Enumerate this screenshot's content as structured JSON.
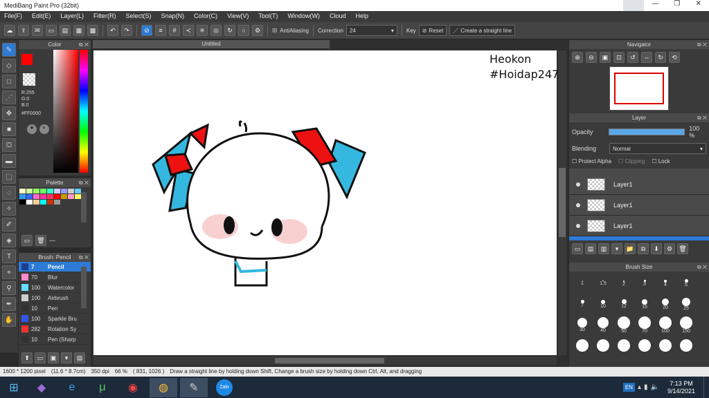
{
  "app": {
    "title": "MediBang Paint Pro (32bit)"
  },
  "menu": [
    "File(F)",
    "Edit(E)",
    "Layer(L)",
    "Filter(R)",
    "Select(S)",
    "Snap(N)",
    "Color(C)",
    "View(V)",
    "Tool(T)",
    "Window(W)",
    "Cloud",
    "Help"
  ],
  "toolbar": {
    "antialias_label": "AntiAliasing",
    "correction_label": "Correction",
    "correction_value": "24",
    "key_label": "Key",
    "reset_label": "Reset",
    "straight_line_label": "Create a straight line"
  },
  "color_panel": {
    "title": "Color",
    "r": "R:255",
    "g": "G:0",
    "b": "B:0",
    "hex": "#FF0000",
    "primary": "#ff0000",
    "secondary": "#ff8c00"
  },
  "palette": {
    "title": "Palette",
    "more_label": "---",
    "colors": [
      "#ffffcc",
      "#ccff99",
      "#99ff66",
      "#66ff66",
      "#33ffcc",
      "#ccccff",
      "#9999ff",
      "#cccccc",
      "#66ccff",
      "#3399ff",
      "#3366ff",
      "#ff66cc",
      "#ff3399",
      "#ff3366",
      "#ff0000",
      "#cc9900",
      "#ff99cc",
      "#ffff66",
      "#000000",
      "#ffffff",
      "#ffcc99",
      "#00ffff",
      "#cc3300",
      "#999999"
    ]
  },
  "brush_panel": {
    "title": "Brush: Pencil",
    "items": [
      {
        "size": "7",
        "name": "Pencil",
        "color": "#1f3e8c"
      },
      {
        "size": "70",
        "name": "Blur",
        "color": "#ff88cc"
      },
      {
        "size": "100",
        "name": "Watercolor",
        "color": "#66ddff"
      },
      {
        "size": "100",
        "name": "Airbrush",
        "color": "#cccccc"
      },
      {
        "size": "10",
        "name": "Pen",
        "color": "#333333"
      },
      {
        "size": "100",
        "name": "Sparkle Bru",
        "color": "#3355ee"
      },
      {
        "size": "282",
        "name": "Rotation Sy",
        "color": "#ff3333"
      },
      {
        "size": "10",
        "name": "Pen (Sharp",
        "color": "#333333"
      }
    ]
  },
  "canvas": {
    "tab_title": "Untitled",
    "overlay_line1": "Heokon",
    "overlay_line2": "#Hoidap247"
  },
  "navigator": {
    "title": "Navigator"
  },
  "layer_panel": {
    "title": "Layer",
    "opacity_label": "Opacity",
    "opacity_value": "100 %",
    "blending_label": "Blending",
    "blending_value": "Normal",
    "protect_alpha": "Protect Alpha",
    "clipping": "Clipping",
    "lock": "Lock",
    "layers": [
      "Layer1",
      "Layer1",
      "Layer1"
    ]
  },
  "brush_size_panel": {
    "title": "Brush Size",
    "sizes": [
      "1",
      "1.5",
      "2",
      "3",
      "4",
      "5",
      "7",
      "10",
      "12",
      "15",
      "20",
      "25",
      "30",
      "40",
      "50",
      "70",
      "100",
      "150"
    ]
  },
  "status": {
    "dims": "1600 * 1200 pixel",
    "cm": "(11.6 * 8.7cm)",
    "dpi": "350 dpi",
    "zoom": "66 %",
    "coords": "( 831, 1026 )",
    "hint": "Draw a straight line by holding down Shift, Change a brush size by holding down Ctrl, Alt, and dragging"
  },
  "taskbar": {
    "lang": "EN",
    "time": "7:13 PM",
    "date": "9/14/2021",
    "zalo_label": "Zalo"
  }
}
